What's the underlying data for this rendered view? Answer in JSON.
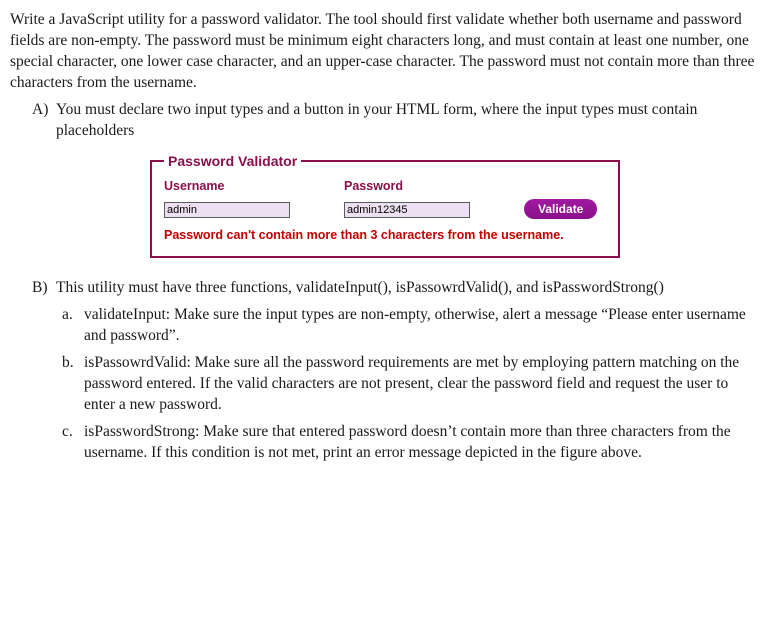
{
  "intro": "Write a JavaScript utility for a password validator. The tool should first validate whether both username and password fields are non-empty. The password must be minimum eight characters long, and must contain at least one number, one special character, one lower case character, and an upper-case character. The password must not contain more than three characters from the username.",
  "itemA": {
    "letter": "A)",
    "text": "You must declare two input types and a button in your HTML form, where the input types must contain placeholders"
  },
  "form": {
    "legend": "Password Validator",
    "usernameLabel": "Username",
    "passwordLabel": "Password",
    "usernameValue": "admin",
    "passwordValue": "admin12345",
    "buttonLabel": "Validate",
    "errorMessage": "Password can't contain more than 3 characters from the username."
  },
  "itemB": {
    "letter": "B)",
    "text": "This utility must have three functions, validateInput(), isPassowrdValid(), and isPasswordStrong()",
    "sub": {
      "a": {
        "letter": "a.",
        "text": "validateInput: Make sure the input types are non-empty, otherwise, alert a message “Please enter username and password”."
      },
      "b": {
        "letter": "b.",
        "text": "isPassowrdValid: Make sure all the password requirements are met by employing pattern matching on the password entered. If the valid characters are not present, clear the password field and request the user to enter a new password."
      },
      "c": {
        "letter": "c.",
        "text": "isPasswordStrong: Make sure that entered password doesn’t contain more than three characters from the username. If this condition is not met, print an error message depicted in the figure above."
      }
    }
  }
}
